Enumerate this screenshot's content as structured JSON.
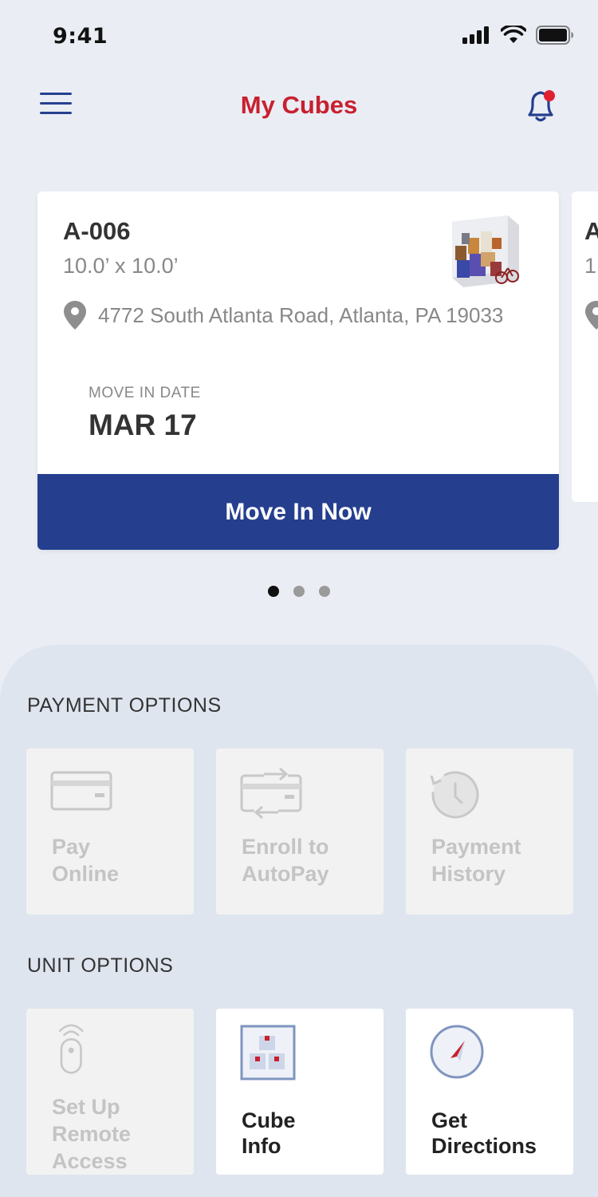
{
  "status_bar": {
    "time": "9:41"
  },
  "header": {
    "title": "My Cubes"
  },
  "units": [
    {
      "id": "A-006",
      "size": "10.0’ x 10.0’",
      "address": "4772 South Atlanta Road, Atlanta, PA 19033",
      "move_in_label": "MOVE IN DATE",
      "move_in_date": "MAR 17",
      "action_label": "Move In Now"
    },
    {
      "id": "A",
      "size": "1"
    }
  ],
  "carousel": {
    "page_count": 3,
    "active_index": 0
  },
  "payment_options": {
    "title": "PAYMENT OPTIONS",
    "items": [
      {
        "line1": "Pay",
        "line2": "Online",
        "icon": "credit-card-icon",
        "enabled": false
      },
      {
        "line1": "Enroll to",
        "line2": "AutoPay",
        "icon": "autopay-card-icon",
        "enabled": false
      },
      {
        "line1": "Payment",
        "line2": "History",
        "icon": "history-clock-icon",
        "enabled": false
      }
    ]
  },
  "unit_options": {
    "title": "UNIT OPTIONS",
    "items": [
      {
        "line1": "Set Up",
        "line2": "Remote",
        "line3": "Access",
        "icon": "remote-icon",
        "enabled": false
      },
      {
        "line1": "Cube",
        "line2": "Info",
        "icon": "cube-info-icon",
        "enabled": true
      },
      {
        "line1": "Get",
        "line2": "Directions",
        "icon": "compass-icon",
        "enabled": true
      }
    ]
  },
  "colors": {
    "brand_blue": "#253f8e",
    "brand_red": "#c8202f",
    "disabled_text": "#c4c4c4"
  }
}
